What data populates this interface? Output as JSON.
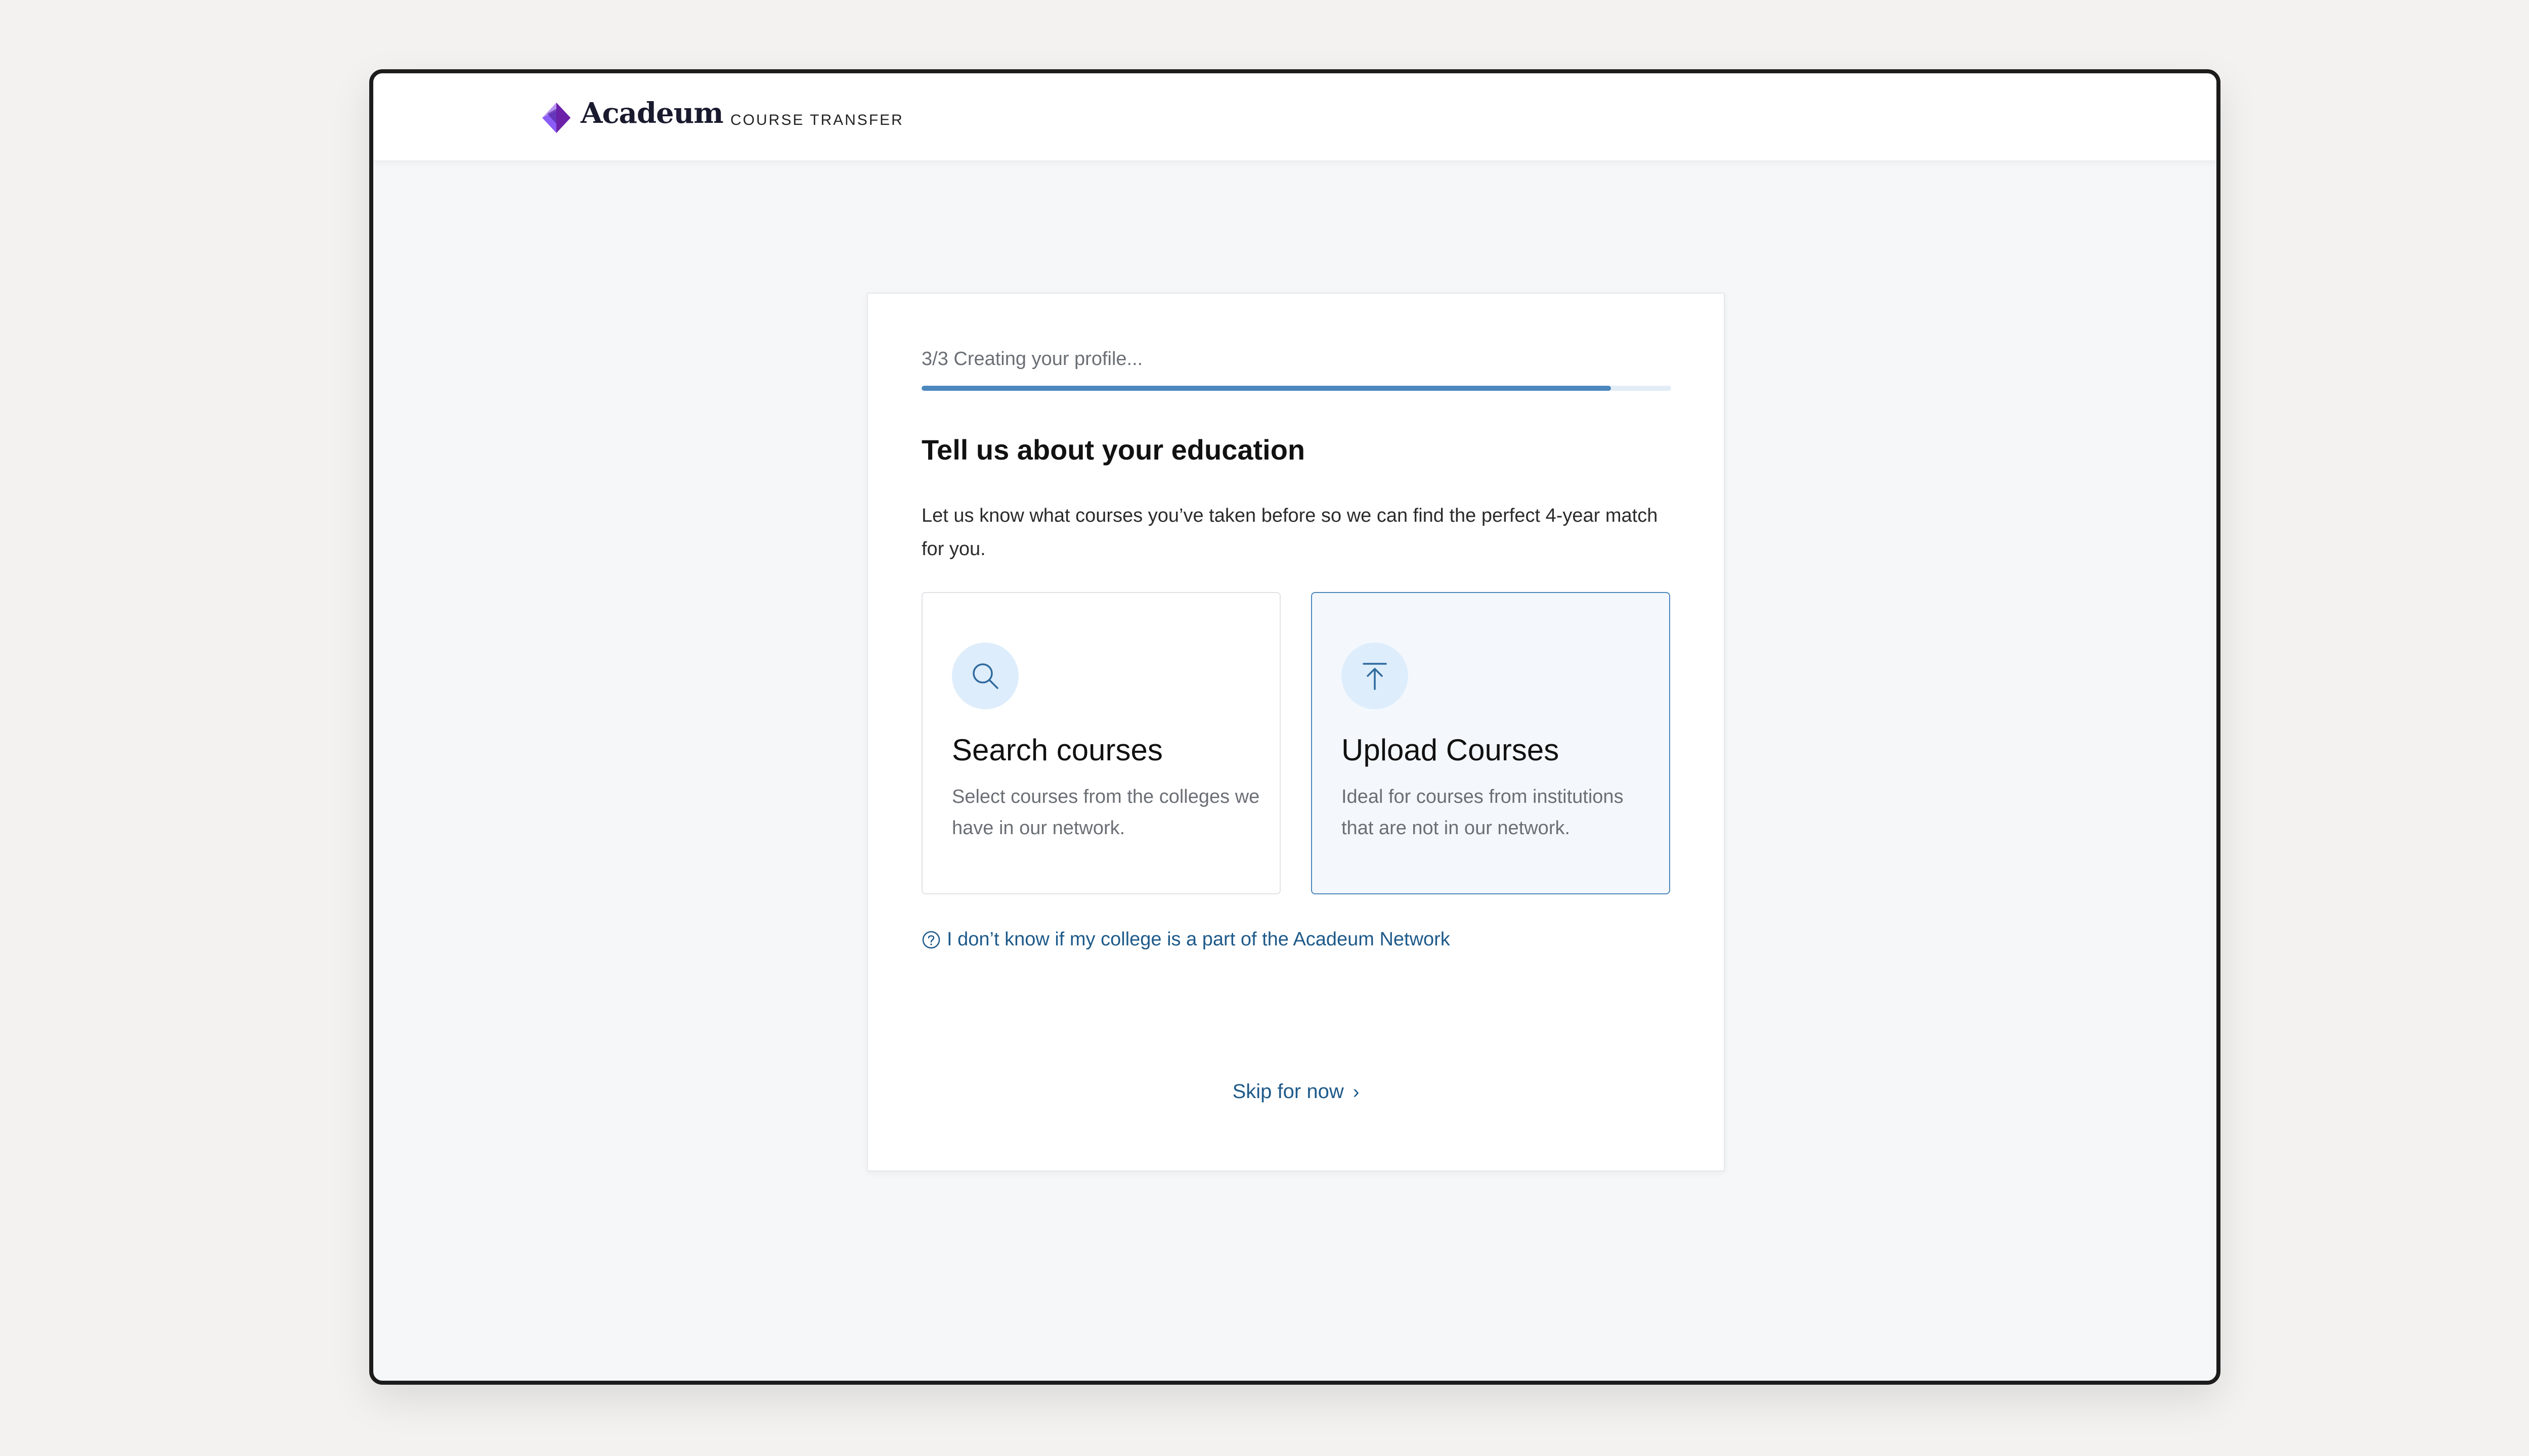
{
  "header": {
    "brand_name": "Acadeum",
    "brand_sub": "COURSE TRANSFER"
  },
  "progress": {
    "label": "3/3 Creating your profile...",
    "value": 0.92
  },
  "main": {
    "heading": "Tell us about your education",
    "intro": "Let us know what courses you’ve taken before so we can find the perfect 4-year match for you."
  },
  "options": [
    {
      "title": "Search courses",
      "description": "Select courses from the colleges we have in our network.",
      "icon": "search-icon"
    },
    {
      "title": "Upload Courses",
      "description": "Ideal for courses from institutions that are not in our network.",
      "icon": "upload-icon"
    }
  ],
  "help_link": {
    "label": "I don’t know if my college is a part of the Acadeum Network",
    "icon": "question-circle-icon"
  },
  "skip": {
    "label": "Skip for now",
    "chevron": "›"
  },
  "colors": {
    "accent": "#4c87bd",
    "link": "#1e5a8a",
    "icon_bg": "#deedfb",
    "brand_purple": "#7a3fd1"
  }
}
